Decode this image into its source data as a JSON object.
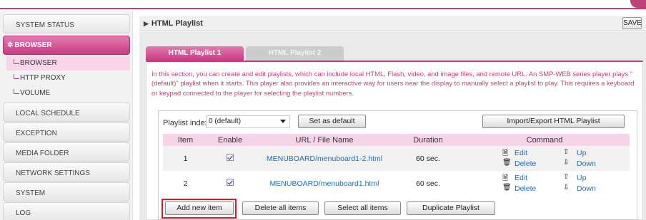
{
  "sidebar": {
    "items": [
      {
        "label": "SYSTEM STATUS"
      },
      {
        "label": "BROWSER"
      },
      {
        "label": "LOCAL SCHEDULE"
      },
      {
        "label": "EXCEPTION"
      },
      {
        "label": "MEDIA FOLDER"
      },
      {
        "label": "NETWORK SETTINGS"
      },
      {
        "label": "SYSTEM"
      },
      {
        "label": "LOG"
      }
    ],
    "subitems": [
      {
        "label": "BROWSER"
      },
      {
        "label": "HTTP PROXY"
      },
      {
        "label": "VOLUME"
      }
    ]
  },
  "header": {
    "title": "HTML Playlist",
    "save_label": "SAVE"
  },
  "tabs": [
    {
      "label": "HTML Playlist 1",
      "active": true
    },
    {
      "label": "HTML Playlist 2",
      "active": false
    }
  ],
  "description": "In this section, you can create and edit playlists, which can include local HTML, Flash, video, and image files, and remote URL. An SMP-WEB series player plays \"(default)\" playlist when it starts. This player also provides an interactive way for users near the display to manually select a playlist to play. This requires a keyboard or keypad connected to the player for selecting the playlist numbers.",
  "playlist": {
    "index_label": "Playlist index",
    "index_value": "0 (default)",
    "set_default_label": "Set as default",
    "import_export_label": "Import/Export HTML Playlist",
    "columns": [
      "Item",
      "Enable",
      "URL / File Name",
      "Duration",
      "Command"
    ],
    "rows": [
      {
        "item": "1",
        "enabled": true,
        "url": "MENUBOARD/menuboard1-2.html",
        "duration": "60 sec."
      },
      {
        "item": "2",
        "enabled": true,
        "url": "MENUBOARD/menuboard1.html",
        "duration": "60 sec."
      }
    ],
    "commands": {
      "edit": "Edit",
      "delete": "Delete",
      "up": "Up",
      "down": "Down"
    },
    "buttons": {
      "add_new": "Add new item",
      "delete_all": "Delete all items",
      "select_all": "Select all items",
      "duplicate": "Duplicate Playlist"
    }
  },
  "colors": {
    "accent": "#c93a82",
    "highlight_box": "#d11f26",
    "link": "#1a6fb8"
  }
}
